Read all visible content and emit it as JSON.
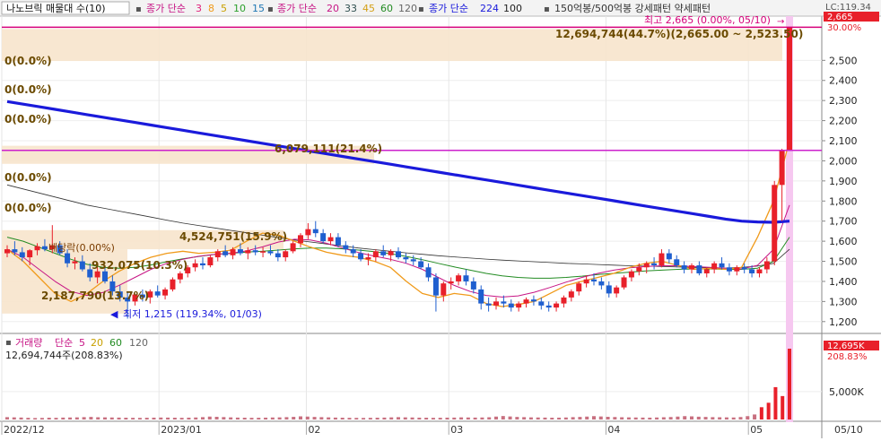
{
  "chart_data": {
    "type": "candlestick",
    "legend": {
      "stock": "나노브릭 매물대 수(10)",
      "ma_price_label": "종가 단순",
      "ma_price_periods": [
        "3",
        "8",
        "5",
        "10",
        "15"
      ],
      "ma_price_label_2": "종가 단순",
      "ma_price_periods_2": [
        "20",
        "33",
        "45",
        "60",
        "120"
      ],
      "ma_long_label": "종가 단순",
      "ma_long_periods": [
        "224",
        "100"
      ],
      "pattern_text": "150억봉/500억봉 강세패턴 약세패턴",
      "colors": {
        "ma3": "#e0207a",
        "ma8": "#f09a1a",
        "ma5": "#c8a000",
        "ma10": "#2ca02c",
        "ma15": "#1f77b4",
        "ma20": "#c71585",
        "ma33": "#2f4f4f",
        "ma45": "#d4a017",
        "ma60": "#228b22",
        "ma120": "#666666",
        "ma224": "#1a1adb",
        "ma100": "#222222"
      }
    },
    "y_axis": {
      "min": 1150,
      "max": 2720,
      "ticks": [
        1200,
        1300,
        1400,
        1500,
        1600,
        1700,
        1800,
        1900,
        2000,
        2100,
        2200,
        2300,
        2400,
        2500
      ],
      "tick_labels": [
        "1,200",
        "1,300",
        "1,400",
        "1,500",
        "1,600",
        "1,700",
        "1,800",
        "1,900",
        "2,000",
        "2,100",
        "2,200",
        "2,300",
        "2,400",
        "2,500"
      ],
      "top_labels": [
        "LC:119.34",
        "2,665",
        "30.00%"
      ],
      "current_price": 2665
    },
    "x_axis": {
      "labels": [
        "2022/12",
        "2023/01",
        "02",
        "03",
        "04",
        "05",
        "05/10"
      ],
      "label_dates": [
        "2022-12-01",
        "2023-01-02",
        "2023-02-01",
        "2023-03-02",
        "2023-04-03",
        "2023-05-02",
        "2023-05-10"
      ]
    },
    "annotations": {
      "high": "최고 2,665 (0.00%, 05/10)",
      "high_range": "12,694,744(44.7%)(2,665.00 ~ 2,523.50)",
      "low": "최저 1,215 (119.34%, 01/03)",
      "zero_pcts": [
        "0(0.0%)",
        "0(0.0%)",
        "0(0.0%)",
        "0(0.0%)",
        "0(0.0%)"
      ],
      "profiles": [
        {
          "text": "6,079,111(21.4%)",
          "price_low": 1985,
          "price_high": 2075
        },
        {
          "text": "4,524,751(15.9%)",
          "price_low": 1560,
          "price_high": 1655
        },
        {
          "text": "932,075(10.3%)",
          "price_low": 1460,
          "price_high": 1560
        },
        {
          "text": "2,187,790(13.7%)",
          "price_low": 1240,
          "price_high": 1460
        }
      ],
      "dividend": "배당락(0.00%)",
      "hline_price": 2052
    },
    "volume": {
      "legend_label": "거래량",
      "legend_ma_label": "단순",
      "legend_periods": [
        "5",
        "20",
        "60",
        "120"
      ],
      "current": "12,694,744주(208.83%)",
      "badge_value": "12,695K",
      "badge_pct": "208.83%",
      "ticks": [
        5000
      ],
      "tick_labels": [
        "5,000K"
      ],
      "max": 13500,
      "values_k": [
        420,
        380,
        350,
        300,
        260,
        280,
        320,
        300,
        340,
        360,
        380,
        420,
        460,
        400,
        380,
        360,
        340,
        320,
        300,
        290,
        310,
        330,
        350,
        340,
        320,
        300,
        330,
        360,
        420,
        520,
        480,
        430,
        380,
        340,
        320,
        300,
        310,
        330,
        360,
        380,
        420,
        470,
        560,
        520,
        460,
        420,
        380,
        340,
        320,
        300,
        290,
        280,
        300,
        320,
        340,
        380,
        420,
        380,
        360,
        330,
        320,
        300,
        310,
        330,
        340,
        380,
        360,
        340,
        360,
        400,
        520,
        620,
        540,
        460,
        420,
        380,
        360,
        340,
        320,
        330,
        360,
        420,
        460,
        520,
        600,
        540,
        480,
        440,
        400,
        380,
        360,
        340,
        330,
        360,
        400,
        440,
        520,
        600,
        560,
        500,
        460,
        420,
        400,
        380,
        360,
        440,
        600,
        900,
        2200,
        3000,
        5800,
        4200,
        12695
      ]
    },
    "candles": [
      [
        1540,
        1580,
        1520,
        1560
      ],
      [
        1560,
        1600,
        1530,
        1545
      ],
      [
        1545,
        1570,
        1500,
        1520
      ],
      [
        1520,
        1560,
        1480,
        1555
      ],
      [
        1555,
        1590,
        1530,
        1575
      ],
      [
        1575,
        1610,
        1550,
        1560
      ],
      [
        1560,
        1680,
        1540,
        1580
      ],
      [
        1580,
        1600,
        1530,
        1540
      ],
      [
        1540,
        1560,
        1470,
        1490
      ],
      [
        1490,
        1520,
        1460,
        1500
      ],
      [
        1500,
        1530,
        1450,
        1460
      ],
      [
        1460,
        1490,
        1400,
        1420
      ],
      [
        1420,
        1470,
        1390,
        1450
      ],
      [
        1450,
        1480,
        1390,
        1400
      ],
      [
        1400,
        1430,
        1330,
        1350
      ],
      [
        1350,
        1380,
        1300,
        1320
      ],
      [
        1320,
        1350,
        1215,
        1300
      ],
      [
        1300,
        1340,
        1280,
        1335
      ],
      [
        1335,
        1360,
        1300,
        1320
      ],
      [
        1320,
        1360,
        1290,
        1350
      ],
      [
        1350,
        1380,
        1320,
        1330
      ],
      [
        1330,
        1370,
        1310,
        1360
      ],
      [
        1360,
        1420,
        1350,
        1410
      ],
      [
        1410,
        1450,
        1390,
        1440
      ],
      [
        1440,
        1480,
        1420,
        1470
      ],
      [
        1470,
        1510,
        1450,
        1490
      ],
      [
        1490,
        1520,
        1460,
        1480
      ],
      [
        1480,
        1530,
        1470,
        1520
      ],
      [
        1520,
        1560,
        1500,
        1550
      ],
      [
        1550,
        1580,
        1520,
        1530
      ],
      [
        1530,
        1570,
        1510,
        1560
      ],
      [
        1560,
        1590,
        1530,
        1540
      ],
      [
        1540,
        1570,
        1510,
        1555
      ],
      [
        1555,
        1580,
        1530,
        1545
      ],
      [
        1545,
        1570,
        1520,
        1550
      ],
      [
        1550,
        1580,
        1530,
        1540
      ],
      [
        1540,
        1560,
        1500,
        1520
      ],
      [
        1520,
        1560,
        1500,
        1550
      ],
      [
        1550,
        1600,
        1540,
        1590
      ],
      [
        1590,
        1640,
        1570,
        1630
      ],
      [
        1630,
        1690,
        1610,
        1660
      ],
      [
        1660,
        1700,
        1620,
        1640
      ],
      [
        1640,
        1660,
        1590,
        1600
      ],
      [
        1600,
        1640,
        1580,
        1620
      ],
      [
        1620,
        1640,
        1570,
        1580
      ],
      [
        1580,
        1600,
        1540,
        1560
      ],
      [
        1560,
        1580,
        1520,
        1540
      ],
      [
        1540,
        1560,
        1500,
        1510
      ],
      [
        1510,
        1540,
        1480,
        1520
      ],
      [
        1520,
        1560,
        1500,
        1550
      ],
      [
        1550,
        1580,
        1520,
        1530
      ],
      [
        1530,
        1560,
        1500,
        1550
      ],
      [
        1550,
        1570,
        1510,
        1520
      ],
      [
        1520,
        1540,
        1490,
        1510
      ],
      [
        1510,
        1530,
        1480,
        1500
      ],
      [
        1500,
        1520,
        1460,
        1470
      ],
      [
        1470,
        1490,
        1400,
        1420
      ],
      [
        1420,
        1440,
        1250,
        1330
      ],
      [
        1330,
        1400,
        1300,
        1390
      ],
      [
        1390,
        1420,
        1360,
        1400
      ],
      [
        1400,
        1440,
        1380,
        1430
      ],
      [
        1430,
        1460,
        1380,
        1400
      ],
      [
        1400,
        1420,
        1340,
        1360
      ],
      [
        1360,
        1380,
        1260,
        1290
      ],
      [
        1290,
        1320,
        1250,
        1280
      ],
      [
        1280,
        1320,
        1260,
        1300
      ],
      [
        1300,
        1330,
        1270,
        1290
      ],
      [
        1290,
        1310,
        1250,
        1270
      ],
      [
        1270,
        1300,
        1250,
        1290
      ],
      [
        1290,
        1320,
        1270,
        1310
      ],
      [
        1310,
        1330,
        1280,
        1300
      ],
      [
        1300,
        1320,
        1260,
        1280
      ],
      [
        1280,
        1300,
        1250,
        1270
      ],
      [
        1270,
        1300,
        1250,
        1290
      ],
      [
        1290,
        1330,
        1270,
        1320
      ],
      [
        1320,
        1360,
        1300,
        1350
      ],
      [
        1350,
        1400,
        1330,
        1390
      ],
      [
        1390,
        1430,
        1370,
        1410
      ],
      [
        1410,
        1440,
        1380,
        1400
      ],
      [
        1400,
        1420,
        1360,
        1380
      ],
      [
        1380,
        1400,
        1320,
        1340
      ],
      [
        1340,
        1380,
        1320,
        1370
      ],
      [
        1370,
        1430,
        1360,
        1420
      ],
      [
        1420,
        1460,
        1400,
        1450
      ],
      [
        1450,
        1490,
        1430,
        1470
      ],
      [
        1470,
        1500,
        1440,
        1490
      ],
      [
        1490,
        1520,
        1460,
        1480
      ],
      [
        1480,
        1560,
        1470,
        1540
      ],
      [
        1540,
        1560,
        1490,
        1510
      ],
      [
        1510,
        1530,
        1470,
        1480
      ],
      [
        1480,
        1500,
        1440,
        1460
      ],
      [
        1460,
        1490,
        1440,
        1480
      ],
      [
        1480,
        1500,
        1430,
        1440
      ],
      [
        1440,
        1470,
        1420,
        1460
      ],
      [
        1460,
        1500,
        1440,
        1490
      ],
      [
        1490,
        1520,
        1460,
        1470
      ],
      [
        1470,
        1490,
        1430,
        1450
      ],
      [
        1450,
        1480,
        1430,
        1470
      ],
      [
        1470,
        1490,
        1440,
        1460
      ],
      [
        1460,
        1480,
        1420,
        1440
      ],
      [
        1440,
        1470,
        1420,
        1460
      ],
      [
        1460,
        1520,
        1440,
        1500
      ],
      [
        1500,
        1900,
        1480,
        1880
      ],
      [
        1880,
        2060,
        1700,
        2050
      ],
      [
        2050,
        2665,
        2280,
        2665
      ]
    ],
    "ma": {
      "ma224": [
        2295,
        2282,
        2269,
        2256,
        2243,
        2230,
        2217,
        2204,
        2191,
        2178,
        2165,
        2152,
        2139,
        2126,
        2113,
        2100,
        2087,
        2074,
        2061,
        2048,
        2035,
        2022,
        2009,
        1996,
        1983,
        1970,
        1957,
        1944,
        1931,
        1918,
        1905,
        1892,
        1879,
        1866,
        1853,
        1840,
        1827,
        1814,
        1801,
        1788,
        1775,
        1762,
        1749,
        1736,
        1723,
        1710,
        1700,
        1696,
        1694,
        1700
      ],
      "ma100": [
        1880,
        1860,
        1840,
        1820,
        1800,
        1780,
        1765,
        1750,
        1735,
        1720,
        1705,
        1690,
        1678,
        1666,
        1654,
        1642,
        1630,
        1618,
        1606,
        1596,
        1586,
        1576,
        1566,
        1558,
        1550,
        1542,
        1535,
        1528,
        1522,
        1516,
        1511,
        1506,
        1502,
        1498,
        1494,
        1490,
        1487,
        1484,
        1481,
        1478,
        1476,
        1474,
        1472,
        1470,
        1468,
        1466,
        1470,
        1476,
        1490,
        1560
      ],
      "ma60": [
        1620,
        1600,
        1570,
        1540,
        1510,
        1485,
        1470,
        1466,
        1470,
        1482,
        1498,
        1512,
        1524,
        1534,
        1540,
        1546,
        1550,
        1556,
        1562,
        1566,
        1566,
        1562,
        1556,
        1548,
        1538,
        1524,
        1508,
        1490,
        1472,
        1456,
        1440,
        1428,
        1420,
        1416,
        1416,
        1420,
        1426,
        1434,
        1440,
        1446,
        1452,
        1456,
        1460,
        1462,
        1462,
        1460,
        1460,
        1466,
        1500,
        1620
      ],
      "ma20": [
        1560,
        1520,
        1460,
        1400,
        1350,
        1330,
        1345,
        1380,
        1420,
        1460,
        1490,
        1510,
        1525,
        1535,
        1540,
        1552,
        1572,
        1596,
        1610,
        1606,
        1590,
        1566,
        1544,
        1526,
        1510,
        1490,
        1460,
        1420,
        1380,
        1350,
        1330,
        1322,
        1328,
        1346,
        1370,
        1396,
        1420,
        1440,
        1456,
        1468,
        1474,
        1478,
        1478,
        1474,
        1470,
        1466,
        1462,
        1480,
        1560,
        1780
      ],
      "ma5": [
        1560,
        1500,
        1420,
        1340,
        1300,
        1340,
        1400,
        1450,
        1490,
        1520,
        1540,
        1550,
        1540,
        1545,
        1555,
        1600,
        1640,
        1630,
        1600,
        1570,
        1545,
        1530,
        1520,
        1500,
        1470,
        1400,
        1340,
        1320,
        1340,
        1330,
        1290,
        1275,
        1285,
        1300,
        1340,
        1380,
        1400,
        1420,
        1440,
        1470,
        1490,
        1500,
        1480,
        1460,
        1465,
        1460,
        1470,
        1620,
        1800,
        2100
      ]
    }
  }
}
